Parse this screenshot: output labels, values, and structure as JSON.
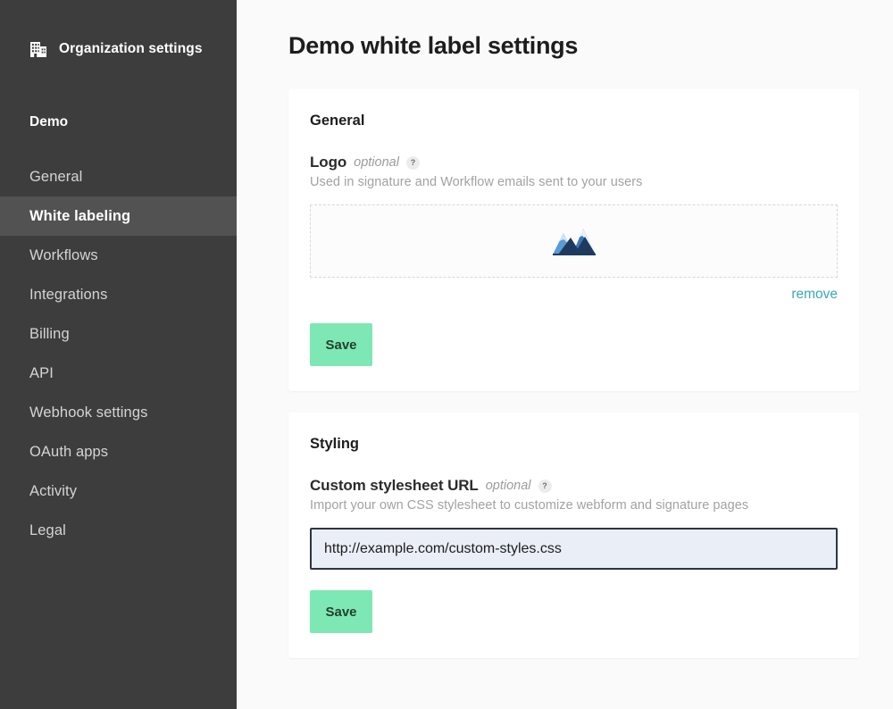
{
  "sidebar": {
    "header": {
      "icon": "building-icon",
      "title": "Organization settings"
    },
    "org_name": "Demo",
    "items": [
      {
        "label": "General",
        "active": false
      },
      {
        "label": "White labeling",
        "active": true
      },
      {
        "label": "Workflows",
        "active": false
      },
      {
        "label": "Integrations",
        "active": false
      },
      {
        "label": "Billing",
        "active": false
      },
      {
        "label": "API",
        "active": false
      },
      {
        "label": "Webhook settings",
        "active": false
      },
      {
        "label": "OAuth apps",
        "active": false
      },
      {
        "label": "Activity",
        "active": false
      },
      {
        "label": "Legal",
        "active": false
      }
    ]
  },
  "main": {
    "page_title": "Demo white label settings",
    "cards": [
      {
        "title": "General",
        "field": {
          "label": "Logo",
          "optional": "optional",
          "help": "?",
          "description": "Used in signature and Workflow emails sent to your users"
        },
        "dropzone": {
          "icon": "mountain-logo-image"
        },
        "remove_label": "remove",
        "save_label": "Save"
      },
      {
        "title": "Styling",
        "field": {
          "label": "Custom stylesheet URL",
          "optional": "optional",
          "help": "?",
          "description": "Import your own CSS stylesheet to customize webform and signature pages"
        },
        "input": {
          "value": "http://example.com/custom-styles.css",
          "placeholder": "http://example.com/custom-styles.css"
        },
        "save_label": "Save"
      }
    ]
  },
  "colors": {
    "sidebar_bg": "#3d3d3d",
    "sidebar_active_bg": "#525252",
    "page_bg": "#fafafa",
    "card_bg": "#ffffff",
    "accent_green": "#7de8b4",
    "link_teal": "#3aa8b8",
    "input_focus_border": "#2e3440",
    "input_focus_bg": "#e9eef7"
  }
}
